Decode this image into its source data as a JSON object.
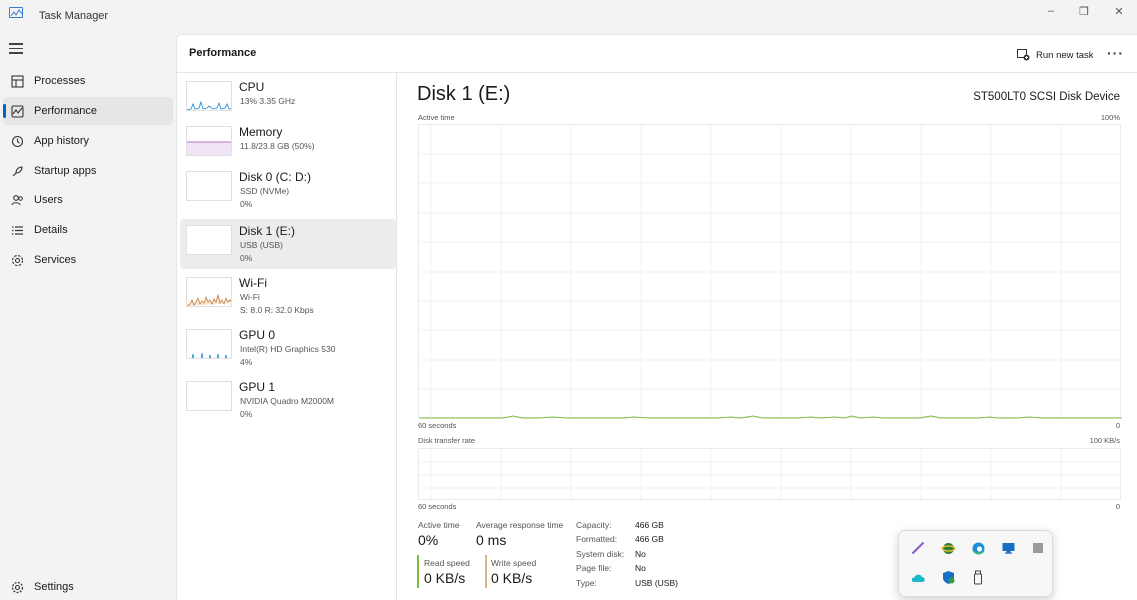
{
  "window": {
    "title": "Task Manager",
    "controls": {
      "minimize": "–",
      "restore": "❐",
      "close": "✕"
    }
  },
  "nav": {
    "items": [
      {
        "label": "Processes",
        "icon": "processes-icon"
      },
      {
        "label": "Performance",
        "icon": "performance-icon",
        "active": true
      },
      {
        "label": "App history",
        "icon": "history-icon"
      },
      {
        "label": "Startup apps",
        "icon": "startup-icon"
      },
      {
        "label": "Users",
        "icon": "users-icon"
      },
      {
        "label": "Details",
        "icon": "details-icon"
      },
      {
        "label": "Services",
        "icon": "services-icon"
      }
    ],
    "settings": {
      "label": "Settings",
      "icon": "gear-icon"
    }
  },
  "header": {
    "title": "Performance",
    "run_new_task": "Run new task",
    "more": "···"
  },
  "devices": [
    {
      "name": "CPU",
      "line1": "13%  3.35 GHz",
      "line2": "",
      "color": "#1a8ad4"
    },
    {
      "name": "Memory",
      "line1": "11.8/23.8 GB (50%)",
      "line2": "",
      "color": "#9b4db8"
    },
    {
      "name": "Disk 0 (C: D:)",
      "line1": "SSD (NVMe)",
      "line2": "0%",
      "color": "#4caf50"
    },
    {
      "name": "Disk 1 (E:)",
      "line1": "USB (USB)",
      "line2": "0%",
      "color": "#4caf50",
      "selected": true
    },
    {
      "name": "Wi-Fi",
      "line1": "Wi-Fi",
      "line2": "S: 8.0  R: 32.0 Kbps",
      "color": "#c97a3a"
    },
    {
      "name": "GPU 0",
      "line1": "Intel(R) HD Graphics 530",
      "line2": "4%",
      "color": "#1a8ad4"
    },
    {
      "name": "GPU 1",
      "line1": "NVIDIA Quadro M2000M",
      "line2": "0%",
      "color": "#1a8ad4"
    }
  ],
  "detail": {
    "title": "Disk 1 (E:)",
    "model": "ST500LT0  SCSI Disk Device",
    "graph1": {
      "label": "Active time",
      "max": "100%",
      "time": "60 seconds",
      "min": "0"
    },
    "graph2": {
      "label": "Disk transfer rate",
      "max": "100 KB/s",
      "time": "60 seconds",
      "min": "0"
    },
    "stats": {
      "active_time_label": "Active time",
      "active_time_value": "0%",
      "avg_response_label": "Average response time",
      "avg_response_value": "0 ms",
      "read_speed_label": "Read speed",
      "read_speed_value": "0 KB/s",
      "write_speed_label": "Write speed",
      "write_speed_value": "0 KB/s"
    },
    "properties": [
      {
        "label": "Capacity:",
        "value": "466 GB"
      },
      {
        "label": "Formatted:",
        "value": "466 GB"
      },
      {
        "label": "System disk:",
        "value": "No"
      },
      {
        "label": "Page file:",
        "value": "No"
      },
      {
        "label": "Type:",
        "value": "USB (USB)"
      }
    ]
  },
  "tray_popup": {
    "icons": [
      "pen-icon",
      "network-globe-icon",
      "edge-icon",
      "monitor-icon",
      "app-icon",
      "cloud-icon",
      "defender-icon",
      "usb-drive-icon"
    ]
  },
  "colors": {
    "accent": "#0067c0",
    "disk_green": "#4caf50",
    "graph_line": "#7cbf3e"
  }
}
